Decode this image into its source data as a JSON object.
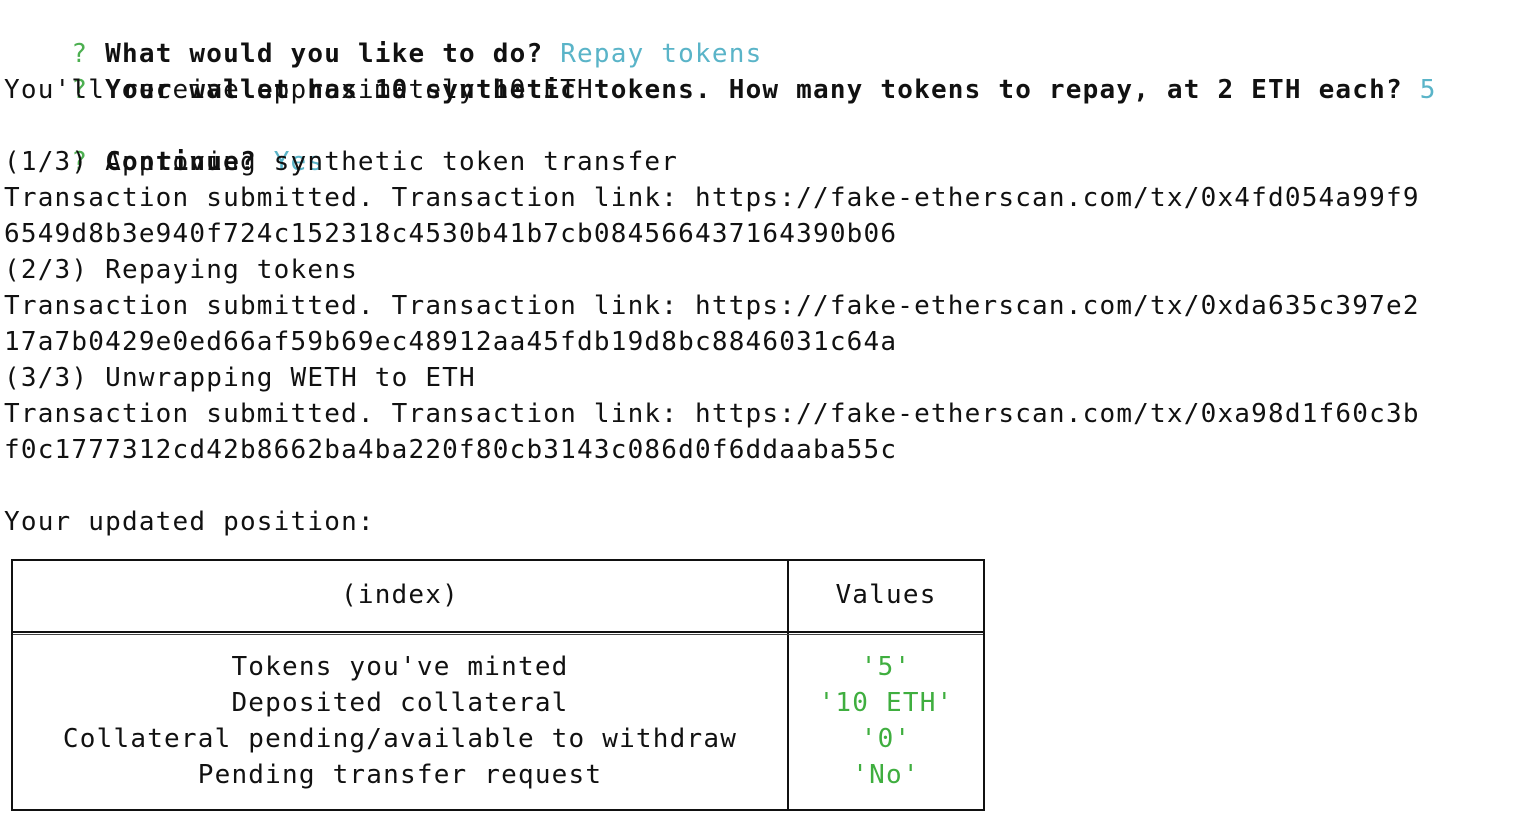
{
  "colors": {
    "prompt_green": "#4caf50",
    "answer_cyan": "#5ab4c8",
    "value_green": "#3fae3f"
  },
  "lines": {
    "q1_mark": "?",
    "q1_text": "What would you like to do?",
    "q1_answer": "Repay tokens",
    "q2_mark": "?",
    "q2_text": "Your wallet has 10 synthetic tokens. How many tokens to repay, at 2 ETH each?",
    "q2_answer": "5",
    "receive": "You'll receive approximately 10 ETH",
    "q3_mark": "?",
    "q3_text": "Continue?",
    "q3_answer": "Yes",
    "step1": "(1/3) Approving synthetic token transfer",
    "tx1_a": "Transaction submitted. Transaction link: https://fake-etherscan.com/tx/0x4fd054a99f9",
    "tx1_b": "6549d8b3e940f724c152318c4530b41b7cb084566437164390b06",
    "step2": "(2/3) Repaying tokens",
    "tx2_a": "Transaction submitted. Transaction link: https://fake-etherscan.com/tx/0xda635c397e2",
    "tx2_b": "17a7b0429e0ed66af59b69ec48912aa45fdb19d8bc8846031c64a",
    "step3": "(3/3) Unwrapping WETH to ETH",
    "tx3_a": "Transaction submitted. Transaction link: https://fake-etherscan.com/tx/0xa98d1f60c3b",
    "tx3_b": "f0c1777312cd42b8662ba4ba220f80cb3143c086d0f6ddaaba55c",
    "position_heading": "Your updated position:"
  },
  "table": {
    "headers": {
      "index": "(index)",
      "values": "Values"
    },
    "rows": [
      {
        "label": "Tokens you've minted",
        "value": "'5'"
      },
      {
        "label": "Deposited collateral",
        "value": "'10 ETH'"
      },
      {
        "label": "Collateral pending/available to withdraw",
        "value": "'0'"
      },
      {
        "label": "Pending transfer request",
        "value": "'No'"
      }
    ]
  }
}
